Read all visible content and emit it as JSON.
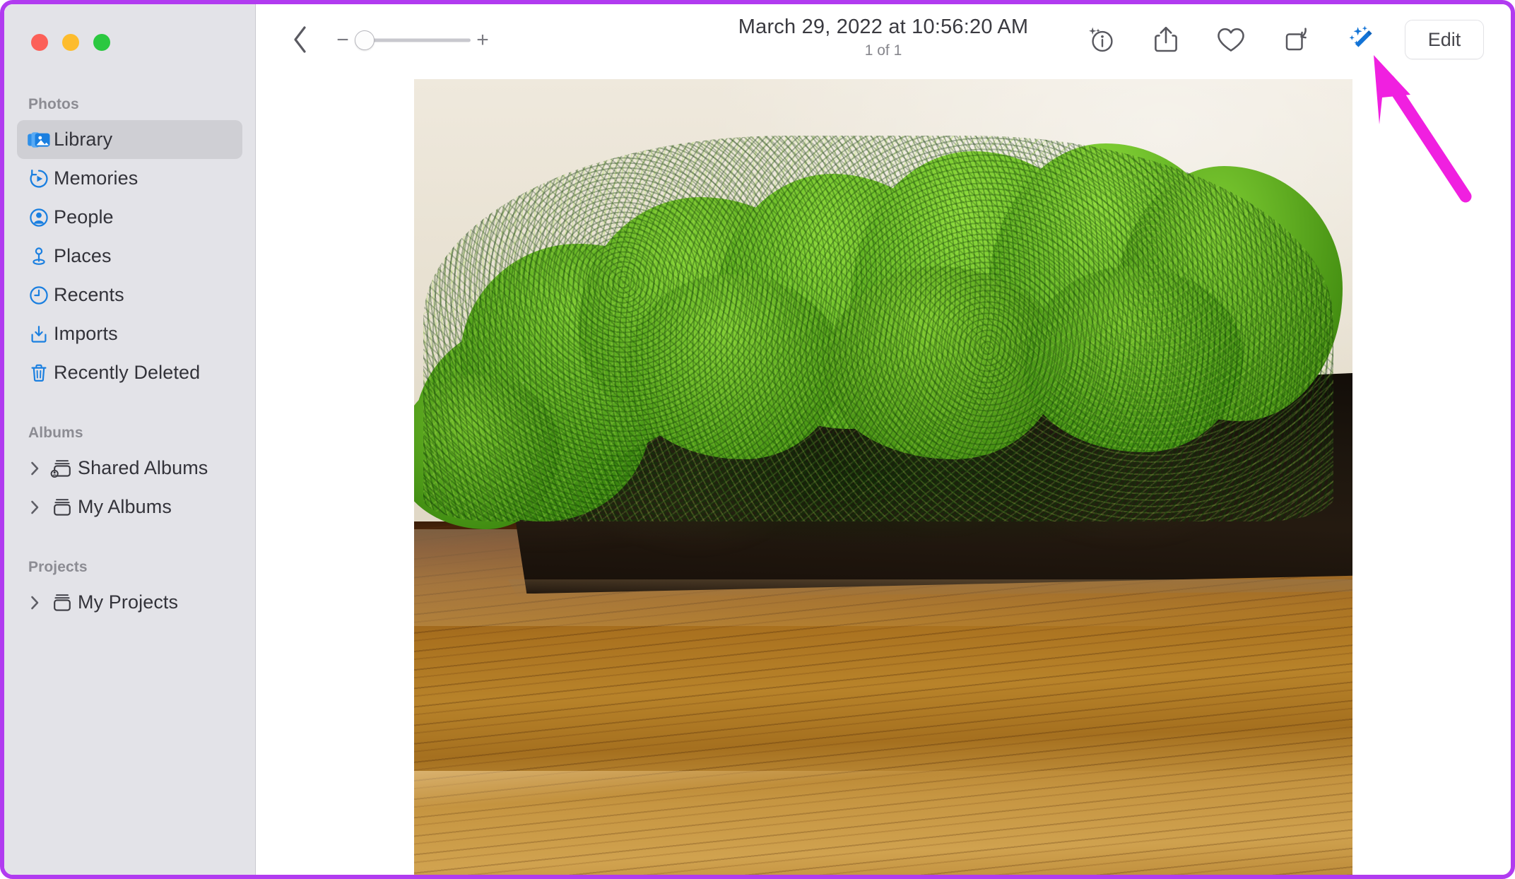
{
  "window": {
    "app": "Photos",
    "traffic_lights": [
      {
        "name": "close",
        "color": "#fc6058"
      },
      {
        "name": "minimize",
        "color": "#fdbc2d"
      },
      {
        "name": "zoom",
        "color": "#2bc840"
      }
    ],
    "annotation_color": "#f020e0",
    "border_color": "#b13bf0"
  },
  "sidebar": {
    "sections": [
      {
        "title": "Photos",
        "items": [
          {
            "label": "Library",
            "icon": "library-icon",
            "selected": true
          },
          {
            "label": "Memories",
            "icon": "memories-icon",
            "selected": false
          },
          {
            "label": "People",
            "icon": "people-icon",
            "selected": false
          },
          {
            "label": "Places",
            "icon": "places-pin-icon",
            "selected": false
          },
          {
            "label": "Recents",
            "icon": "recents-clock-icon",
            "selected": false
          },
          {
            "label": "Imports",
            "icon": "imports-download-icon",
            "selected": false
          },
          {
            "label": "Recently Deleted",
            "icon": "trash-icon",
            "selected": false
          }
        ]
      },
      {
        "title": "Albums",
        "items": [
          {
            "label": "Shared Albums",
            "icon": "shared-album-icon",
            "disclosure": "chevron-right-icon",
            "selected": false
          },
          {
            "label": "My Albums",
            "icon": "album-icon",
            "disclosure": "chevron-right-icon",
            "selected": false
          }
        ]
      },
      {
        "title": "Projects",
        "items": [
          {
            "label": "My Projects",
            "icon": "album-icon",
            "disclosure": "chevron-right-icon",
            "selected": false
          }
        ]
      }
    ]
  },
  "toolbar": {
    "back_icon": "chevron-left-icon",
    "zoom_slider": {
      "minus_label": "−",
      "plus_label": "+",
      "value": 0,
      "min": 0,
      "max": 100
    },
    "title": "March 29, 2022 at 10:56:20 AM",
    "subtitle": "1 of 1",
    "actions": [
      {
        "name": "info-button",
        "icon": "info-sparkle-icon"
      },
      {
        "name": "share-button",
        "icon": "share-icon"
      },
      {
        "name": "favorite-button",
        "icon": "heart-icon"
      },
      {
        "name": "rotate-button",
        "icon": "rotate-icon"
      },
      {
        "name": "enhance-button",
        "icon": "magic-wand-icon",
        "highlighted": true,
        "color": "#1273d6"
      }
    ],
    "edit_label": "Edit"
  },
  "photo": {
    "alt": "Green reindeer moss in a dark rectangular planter on a wooden table",
    "colors": {
      "wall": "#e8e1d2",
      "moss": "#53a617",
      "planter": "#1d160e",
      "wood": "#b8832a"
    }
  }
}
